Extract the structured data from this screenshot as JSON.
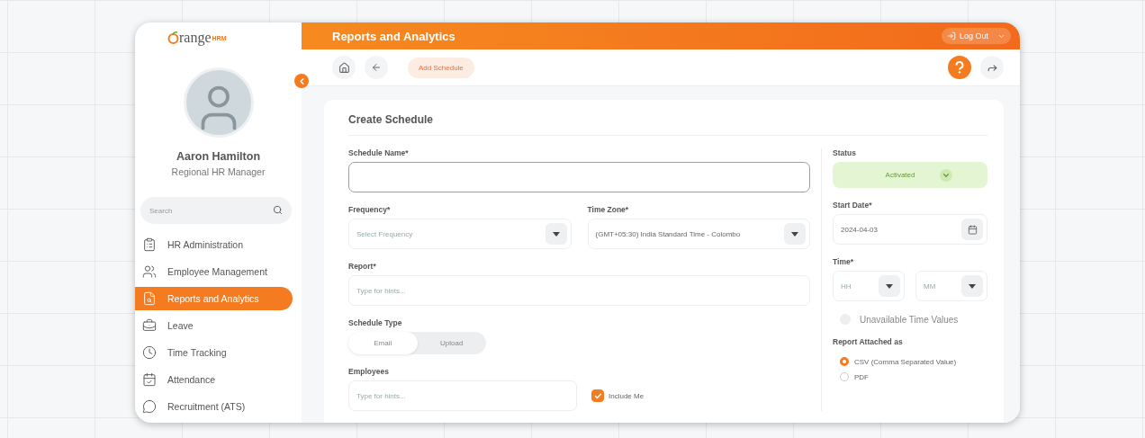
{
  "sidebar": {
    "logo": {
      "name": "range",
      "suffix": "HRM"
    },
    "user": {
      "name": "Aaron Hamilton",
      "role": "Regional HR Manager"
    },
    "search": {
      "placeholder": "Search"
    },
    "items": [
      {
        "label": "HR Administration",
        "selected": false
      },
      {
        "label": "Employee Management",
        "selected": false
      },
      {
        "label": "Reports and Analytics",
        "selected": true
      },
      {
        "label": "Leave",
        "selected": false
      },
      {
        "label": "Time Tracking",
        "selected": false
      },
      {
        "label": "Attendance",
        "selected": false
      },
      {
        "label": "Recruitment (ATS)",
        "selected": false
      }
    ]
  },
  "topbar": {
    "title": "Reports and Analytics",
    "logout": "Log Out"
  },
  "toolbar": {
    "chip": "Add Schedule"
  },
  "form": {
    "title": "Create Schedule",
    "schedule_name": {
      "label": "Schedule Name*"
    },
    "frequency": {
      "label": "Frequency*",
      "placeholder": "Select Frequency"
    },
    "time_zone": {
      "label": "Time Zone*",
      "value": "(GMT+05:30) India Standard Time - Colombo"
    },
    "report": {
      "label": "Report*",
      "placeholder": "Type for hints..."
    },
    "schedule_type": {
      "label": "Schedule Type",
      "options": [
        {
          "label": "Email",
          "selected": true
        },
        {
          "label": "Upload",
          "selected": false
        }
      ]
    },
    "employees": {
      "label": "Employees",
      "placeholder": "Type for hints...",
      "include_me": {
        "label": "Include Me",
        "checked": true
      }
    },
    "status": {
      "label": "Status",
      "value": "Activated"
    },
    "start_date": {
      "label": "Start Date*",
      "value": "2024-04-03"
    },
    "time": {
      "label": "Time*",
      "hour_placeholder": "HH",
      "minute_placeholder": "MM"
    },
    "unavailable": {
      "label": "Unavailable Time Values",
      "checked": false
    },
    "attach": {
      "label": "Report Attached as",
      "options": [
        {
          "label": "CSV (Comma Separated Value)",
          "selected": true
        },
        {
          "label": "PDF",
          "selected": false
        }
      ]
    }
  }
}
